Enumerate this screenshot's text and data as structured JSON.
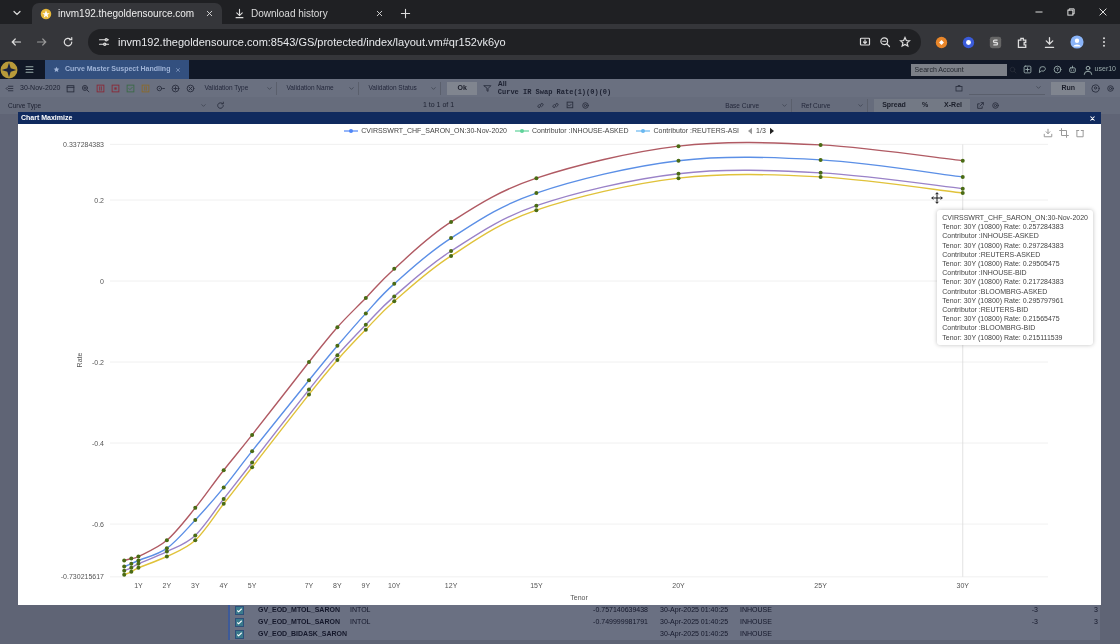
{
  "browser": {
    "tabs": [
      {
        "title": "invm192.thegoldensource.com",
        "selected": true
      },
      {
        "title": "Download history",
        "selected": false
      }
    ],
    "url": "invm192.thegoldensource.com:8543/GS/protected/index/layout.vm#qr152vk6yo"
  },
  "app": {
    "tab": "Curve Master Suspect Handling",
    "search_placeholder": "Search Account",
    "user": "user10"
  },
  "toolbar": {
    "date": "30-Nov-2020",
    "selects": [
      "Validation Type",
      "Validation Name",
      "Validation Status"
    ],
    "ok": "Ok",
    "filter_all": "All",
    "curve_summary": "Curve IR Swap Rate(1)(0)(0)",
    "run": "Run"
  },
  "toolbar2": {
    "curve_type": "Curve Type",
    "paging": "1 to 1 of 1",
    "base_curve": "Base Curve",
    "ref_curve": "Ref Curve",
    "buttons": [
      "Spread",
      "%",
      "X-Rel"
    ]
  },
  "modal": {
    "title": "Chart Maximize",
    "legend": [
      {
        "label": "CVIRSSWRT_CHF_SARON_ON:30-Nov-2020",
        "color": "#4f86f7"
      },
      {
        "label": "Contributor :INHOUSE-ASKED",
        "color": "#5fd39a"
      },
      {
        "label": "Contributor :REUTERS-ASI",
        "color": "#6ab8f0"
      }
    ],
    "legend_page": "1/3",
    "tooltip": [
      "CVIRSSWRT_CHF_SARON_ON:30-Nov-2020",
      "Tenor: 30Y (10800) Rate: 0.257284383",
      "Contributor :INHOUSE-ASKED",
      "Tenor: 30Y (10800) Rate: 0.297284383",
      "Contributor :REUTERS-ASKED",
      "Tenor: 30Y (10800) Rate: 0.29505475",
      "Contributor :INHOUSE-BID",
      "Tenor: 30Y (10800) Rate: 0.217284383",
      "Contributor :BLOOMBRG-ASKED",
      "Tenor: 30Y (10800) Rate: 0.295797961",
      "Contributor :REUTERS-BID",
      "Tenor: 30Y (10800) Rate: 0.21565475",
      "Contributor :BLOOMBRG-BID",
      "Tenor: 30Y (10800) Rate: 0.215111539"
    ],
    "chart_data": {
      "type": "line",
      "xlabel": "Tenor",
      "ylabel": "Rate",
      "x": [
        0.5,
        0.75,
        1,
        2,
        3,
        4,
        5,
        7,
        8,
        9,
        10,
        12,
        15,
        20,
        25,
        30
      ],
      "series": [
        {
          "color": "#b05a63",
          "values": [
            -0.69,
            -0.685,
            -0.68,
            -0.64,
            -0.56,
            -0.467,
            -0.38,
            -0.2,
            -0.114,
            -0.042,
            0.03,
            0.146,
            0.254,
            0.333,
            0.336,
            0.297
          ]
        },
        {
          "color": "#5b8fe6",
          "values": [
            -0.705,
            -0.698,
            -0.69,
            -0.66,
            -0.59,
            -0.51,
            -0.42,
            -0.245,
            -0.16,
            -0.08,
            -0.007,
            0.106,
            0.217,
            0.297,
            0.299,
            0.257
          ]
        },
        {
          "color": "#9a82c8",
          "values": [
            -0.715,
            -0.708,
            -0.698,
            -0.668,
            -0.628,
            -0.538,
            -0.448,
            -0.268,
            -0.183,
            -0.108,
            -0.038,
            0.074,
            0.186,
            0.265,
            0.267,
            0.228
          ]
        },
        {
          "color": "#e0c23a",
          "values": [
            -0.725,
            -0.718,
            -0.708,
            -0.68,
            -0.64,
            -0.55,
            -0.46,
            -0.28,
            -0.195,
            -0.12,
            -0.05,
            0.062,
            0.175,
            0.254,
            0.257,
            0.217
          ]
        }
      ],
      "xlim": [
        0,
        33
      ],
      "ylim": [
        -0.730215617,
        0.337284383
      ],
      "xticks": [
        {
          "value": 1,
          "label": "1Y"
        },
        {
          "value": 2,
          "label": "2Y"
        },
        {
          "value": 3,
          "label": "3Y"
        },
        {
          "value": 4,
          "label": "4Y"
        },
        {
          "value": 5,
          "label": "5Y"
        },
        {
          "value": 7,
          "label": "7Y"
        },
        {
          "value": 8,
          "label": "8Y"
        },
        {
          "value": 9,
          "label": "9Y"
        },
        {
          "value": 10,
          "label": "10Y"
        },
        {
          "value": 12,
          "label": "12Y"
        },
        {
          "value": 15,
          "label": "15Y"
        },
        {
          "value": 20,
          "label": "20Y"
        },
        {
          "value": 25,
          "label": "25Y"
        },
        {
          "value": 30,
          "label": "30Y"
        }
      ],
      "yticks": [
        {
          "value": -0.730215617,
          "label": "-0.730215617"
        },
        -0.6,
        -0.4,
        -0.2,
        0,
        0.2,
        {
          "value": 0.337284383,
          "label": "0.337284383"
        }
      ],
      "grid": true,
      "ref_lines": [
        {
          "axis": "x",
          "value": 30
        }
      ]
    }
  },
  "table": {
    "rows": [
      {
        "checked": true,
        "cells": [
          "GV_EOD_MTOL_SARON",
          "INTOL",
          "-0.757140639438",
          "30-Apr-2025 01:40:25",
          "INHOUSE",
          "-3",
          "3"
        ]
      },
      {
        "checked": true,
        "cells": [
          "GV_EOD_MTOL_SARON",
          "INTOL",
          "-0.749999981791",
          "30-Apr-2025 01:40:25",
          "INHOUSE",
          "-3",
          "3"
        ]
      },
      {
        "checked": true,
        "cells": [
          "GV_EOD_BIDASK_SARON",
          "",
          "",
          "30-Apr-2025 01:40:25",
          "INHOUSE",
          "",
          ""
        ]
      }
    ]
  }
}
